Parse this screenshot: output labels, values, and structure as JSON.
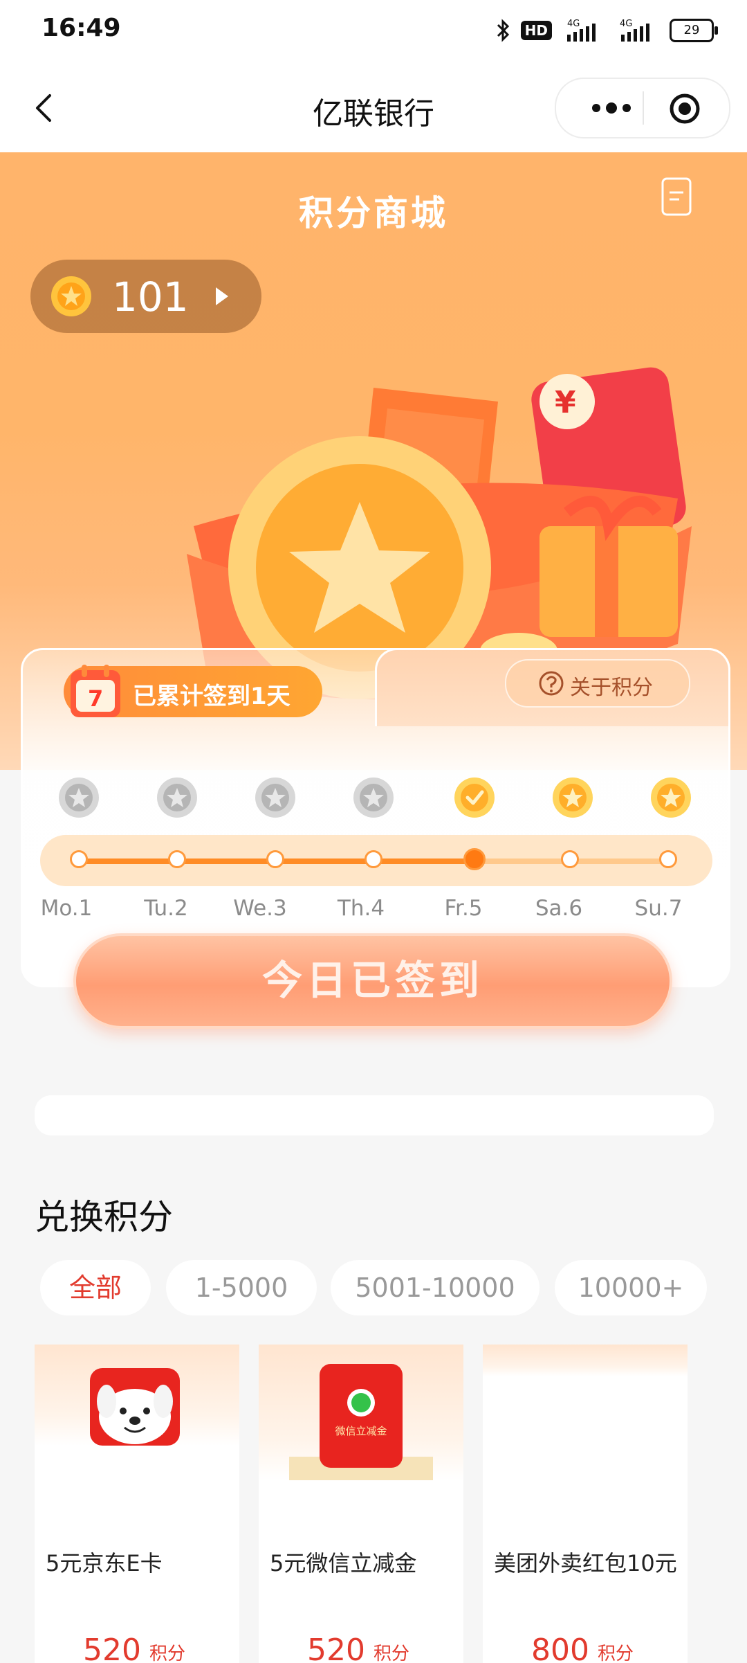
{
  "status_bar": {
    "time": "16:49",
    "battery": "29",
    "network_1": "4G",
    "network_2": "4G",
    "hd_label": "HD"
  },
  "header": {
    "title": "亿联银行"
  },
  "hero": {
    "title": "积分商城",
    "points": "101"
  },
  "checkin": {
    "streak_text": "已累计签到1天",
    "calendar_number": "7",
    "about_label": "关于积分",
    "days": [
      {
        "label": "Mo.1",
        "state": "missed"
      },
      {
        "label": "Tu.2",
        "state": "missed"
      },
      {
        "label": "We.3",
        "state": "missed"
      },
      {
        "label": "Th.4",
        "state": "missed"
      },
      {
        "label": "Fr.5",
        "state": "checked"
      },
      {
        "label": "Sa.6",
        "state": "upcoming"
      },
      {
        "label": "Su.7",
        "state": "upcoming"
      }
    ],
    "today_index": 4,
    "button_label": "今日已签到"
  },
  "exchange": {
    "title": "兑换积分",
    "filters": [
      "全部",
      "1-5000",
      "5001-10000",
      "10000+"
    ],
    "active_filter": 0,
    "products": [
      {
        "name": "5元京东E卡",
        "price": "520",
        "unit": "积分"
      },
      {
        "name": "5元微信立减金",
        "price": "520",
        "unit": "积分",
        "image_text": "微信立减金"
      },
      {
        "name": "美团外卖红包10元",
        "price": "800",
        "unit": "积分"
      }
    ]
  },
  "colors": {
    "accent": "#ff8c26",
    "price": "#e23b2e",
    "hero_bg": "#ffb46b"
  }
}
